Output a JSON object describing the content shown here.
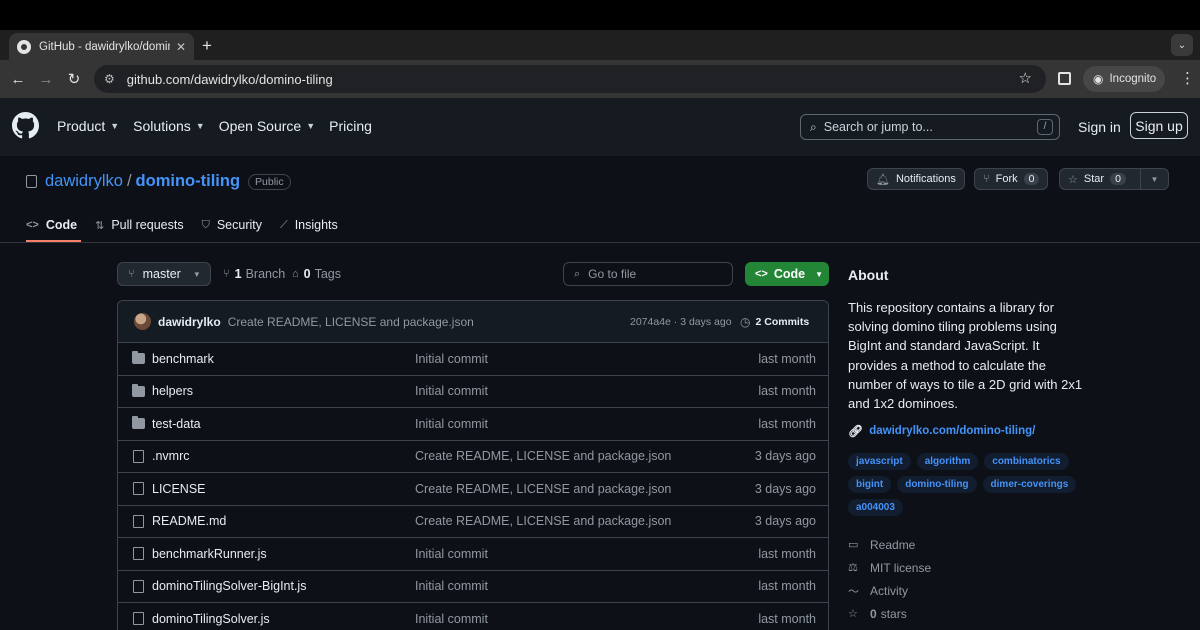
{
  "browser": {
    "tab_title": "GitHub - dawidrylko/domino-tiling",
    "url": "github.com/dawidrylko/domino-tiling",
    "incognito_label": "Incognito"
  },
  "header": {
    "nav": [
      "Product",
      "Solutions",
      "Open Source",
      "Pricing"
    ],
    "search_placeholder": "Search or jump to...",
    "search_shortcut": "/",
    "sign_in": "Sign in",
    "sign_up": "Sign up"
  },
  "repo": {
    "owner": "dawidrylko",
    "separator": "/",
    "name": "domino-tiling",
    "visibility": "Public",
    "notifications_label": "Notifications",
    "fork_label": "Fork",
    "fork_count": "0",
    "star_label": "Star",
    "star_count": "0",
    "tabs": [
      "Code",
      "Pull requests",
      "Security",
      "Insights"
    ]
  },
  "toolbar": {
    "branch": "master",
    "branches_count": "1",
    "branches_label": "Branch",
    "tags_count": "0",
    "tags_label": "Tags",
    "goto_placeholder": "Go to file",
    "code_button": "Code"
  },
  "latest_commit": {
    "author": "dawidrylko",
    "message": "Create README, LICENSE and package.json",
    "sha_time": "2074a4e · 3 days ago",
    "commits_count": "2",
    "commits_label": "Commits"
  },
  "files": [
    {
      "type": "dir",
      "name": "benchmark",
      "message": "Initial commit",
      "date": "last month"
    },
    {
      "type": "dir",
      "name": "helpers",
      "message": "Initial commit",
      "date": "last month"
    },
    {
      "type": "dir",
      "name": "test-data",
      "message": "Initial commit",
      "date": "last month"
    },
    {
      "type": "file",
      "name": ".nvmrc",
      "message": "Create README, LICENSE and package.json",
      "date": "3 days ago"
    },
    {
      "type": "file",
      "name": "LICENSE",
      "message": "Create README, LICENSE and package.json",
      "date": "3 days ago"
    },
    {
      "type": "file",
      "name": "README.md",
      "message": "Create README, LICENSE and package.json",
      "date": "3 days ago"
    },
    {
      "type": "file",
      "name": "benchmarkRunner.js",
      "message": "Initial commit",
      "date": "last month"
    },
    {
      "type": "file",
      "name": "dominoTilingSolver-BigInt.js",
      "message": "Initial commit",
      "date": "last month"
    },
    {
      "type": "file",
      "name": "dominoTilingSolver.js",
      "message": "Initial commit",
      "date": "last month"
    }
  ],
  "about": {
    "heading": "About",
    "description": "This repository contains a library for solving domino tiling problems using BigInt and standard JavaScript. It provides a method to calculate the number of ways to tile a 2D grid with 2x1 and 1x2 dominoes.",
    "website": "dawidrylko.com/domino-tiling/",
    "topics": [
      "javascript",
      "algorithm",
      "combinatorics",
      "bigint",
      "domino-tiling",
      "dimer-coverings",
      "a004003"
    ],
    "links": {
      "readme": "Readme",
      "license": "MIT license",
      "activity": "Activity",
      "stars_count": "0",
      "stars_label": "stars"
    }
  },
  "colors": {
    "accent_link": "#4493f8",
    "code_button": "#238636",
    "tab_underline": "#f78166"
  }
}
